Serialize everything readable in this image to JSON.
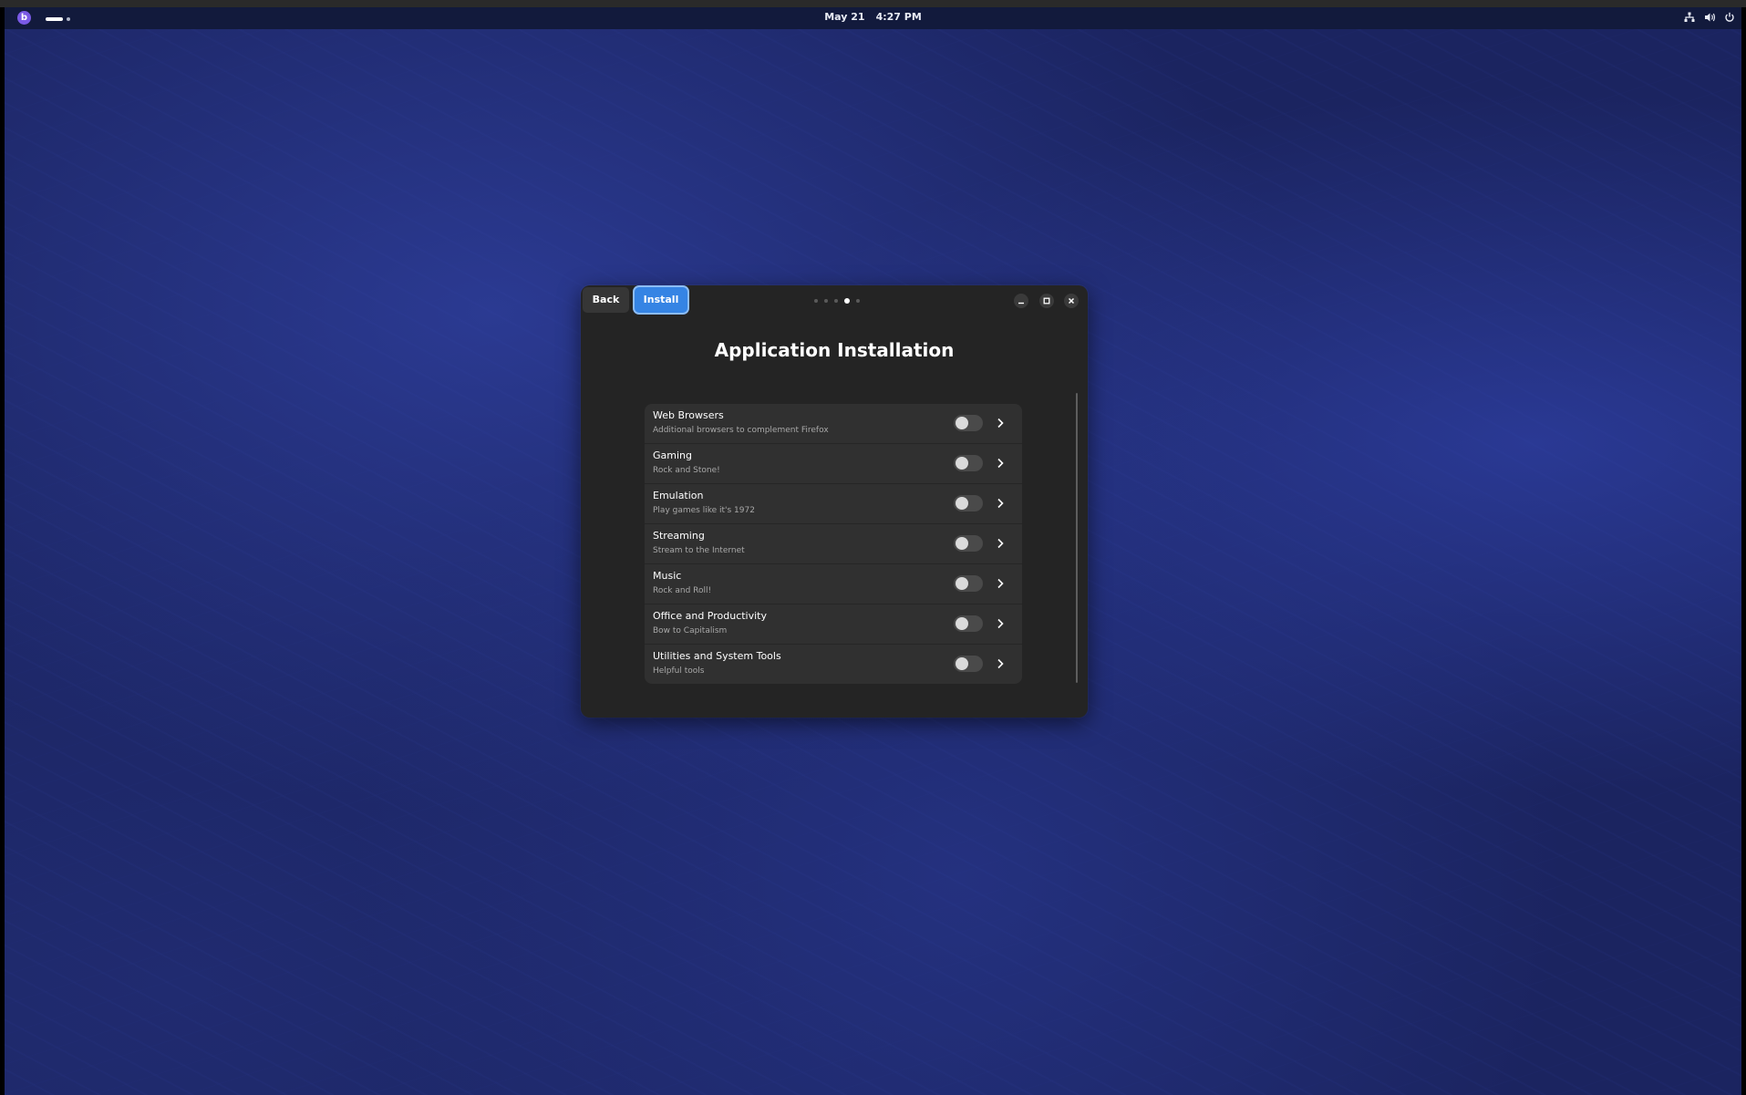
{
  "topbar": {
    "date": "May 21",
    "time": "4:27 PM",
    "logo_glyph": "b",
    "tray_icons": [
      "network-icon",
      "volume-icon",
      "power-icon"
    ]
  },
  "window": {
    "back_label": "Back",
    "install_label": "Install",
    "pager": {
      "total": 5,
      "active": 4
    },
    "title": "Application Installation",
    "accent_color": "#3584e4",
    "categories": [
      {
        "title": "Web Browsers",
        "subtitle": "Additional browsers to complement Firefox",
        "enabled": false
      },
      {
        "title": "Gaming",
        "subtitle": "Rock and Stone!",
        "enabled": false
      },
      {
        "title": "Emulation",
        "subtitle": "Play games like it's 1972",
        "enabled": false
      },
      {
        "title": "Streaming",
        "subtitle": "Stream to the Internet",
        "enabled": false
      },
      {
        "title": "Music",
        "subtitle": "Rock and Roll!",
        "enabled": false
      },
      {
        "title": "Office and Productivity",
        "subtitle": "Bow to Capitalism",
        "enabled": false
      },
      {
        "title": "Utilities and System Tools",
        "subtitle": "Helpful tools",
        "enabled": false
      }
    ]
  }
}
